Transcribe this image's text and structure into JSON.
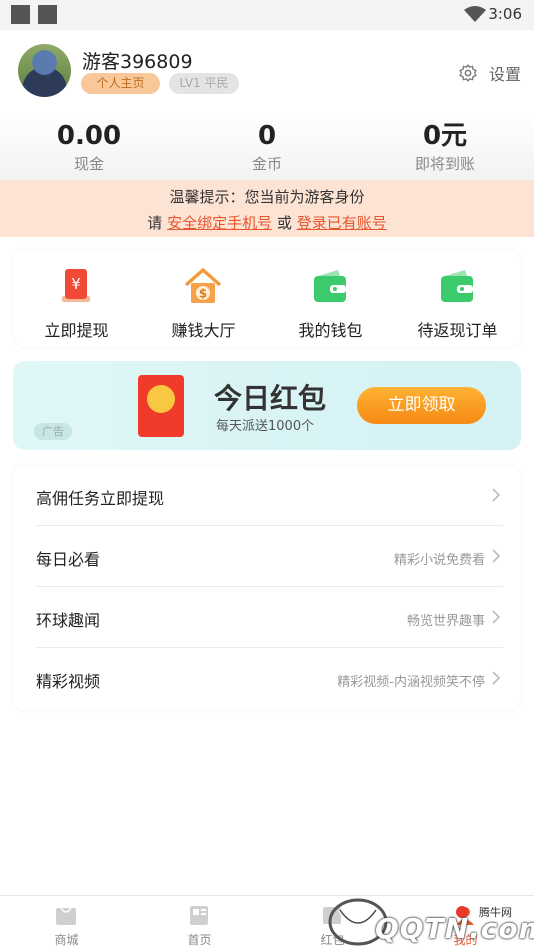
{
  "status_bar": {
    "time": "3:06"
  },
  "profile": {
    "username": "游客396809",
    "home_tag": "个人主页",
    "level_tag": "LV1 平民",
    "settings_label": "设置"
  },
  "stats": [
    {
      "value": "0.00",
      "label": "现金"
    },
    {
      "value": "0",
      "label": "金币"
    },
    {
      "value": "0元",
      "label": "即将到账"
    }
  ],
  "notice": {
    "line1": "温馨提示：您当前为游客身份",
    "prefix": "请",
    "link1": "安全绑定手机号",
    "middle": "或",
    "link2": "登录已有账号"
  },
  "quick_actions": [
    {
      "label": "立即提现",
      "icon": "red-envelope-yuan-icon"
    },
    {
      "label": "赚钱大厅",
      "icon": "house-dollar-icon"
    },
    {
      "label": "我的钱包",
      "icon": "wallet-icon"
    },
    {
      "label": "待返现订单",
      "icon": "wallet-icon"
    }
  ],
  "ad": {
    "title": "今日红包",
    "subtitle": "每天派送1000个",
    "button": "立即领取",
    "tag": "广告"
  },
  "list_items": [
    {
      "title": "高佣任务立即提现",
      "subtitle": ""
    },
    {
      "title": "每日必看",
      "subtitle": "精彩小说免费看"
    },
    {
      "title": "环球趣闻",
      "subtitle": "畅览世界趣事"
    },
    {
      "title": "精彩视频",
      "subtitle": "精彩视频-内涵视频笑不停"
    }
  ],
  "tabs": [
    {
      "label": "商城"
    },
    {
      "label": "首页"
    },
    {
      "label": "红包"
    },
    {
      "label": "我的"
    }
  ],
  "watermark": {
    "text": "QQTN.com",
    "small": "腾牛网"
  },
  "colors": {
    "accent": "#e8562f",
    "notice_bg": "#fde3d4",
    "ad_button": "#f58a14"
  }
}
